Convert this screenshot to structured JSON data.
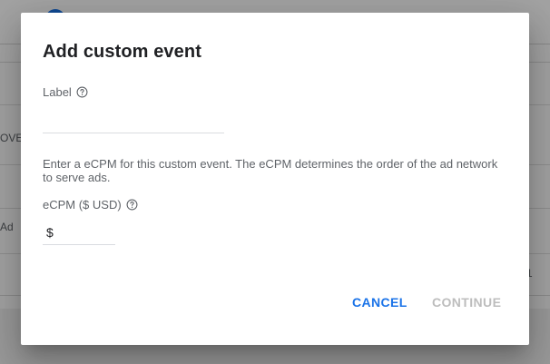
{
  "background": {
    "row_fragments": [
      "OVE",
      "Ad",
      "1"
    ]
  },
  "dialog": {
    "title": "Add custom event",
    "label_field": {
      "label": "Label",
      "value": "",
      "placeholder": ""
    },
    "description": "Enter a eCPM for this custom event. The eCPM determines the order of the ad network to serve ads.",
    "ecpm_field": {
      "label": "eCPM ($ USD)",
      "currency_symbol": "$",
      "value": "",
      "placeholder": ""
    },
    "buttons": {
      "cancel": "CANCEL",
      "continue": "CONTINUE"
    },
    "icons": {
      "help": "help-circle-icon"
    }
  },
  "colors": {
    "accent": "#1a73e8",
    "disabled": "#bdbdbd",
    "title": "#202124",
    "secondary_text": "#5f6368"
  }
}
